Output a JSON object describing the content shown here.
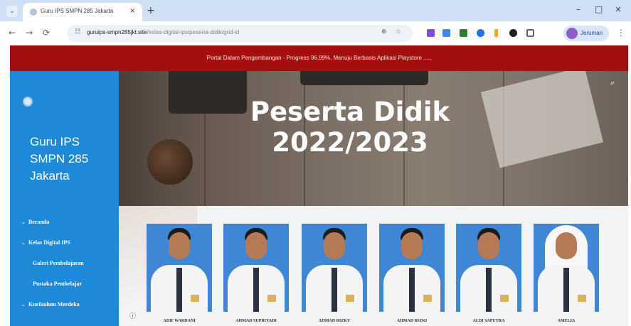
{
  "browser": {
    "tab_title": "Guru IPS SMPN 285 Jakarta",
    "tab_close": "×",
    "new_tab": "+",
    "minimize": "–",
    "maximize": "□",
    "close": "×",
    "url_domain": "guruips-smpn285jkt.site",
    "url_path": "/kelas-digital-ips/peserta-didik/grid-id",
    "profile_label": "Jeruman",
    "back": "←",
    "forward": "→",
    "reload": "⟳",
    "menu": "⋮",
    "extension_colors": [
      "#7b4fd6",
      "#4285f4",
      "#2e7d32",
      "#1a73e8",
      "#f9ab00",
      "#202124",
      "#5f6368"
    ]
  },
  "announcement": "Portal Dalam Pengembangan - Progress 96,99%, Menuju Berbasis Aplikasi Playstore .....",
  "sidebar": {
    "site_title_lines": [
      "Guru IPS",
      "SMPN 285",
      "Jakarta"
    ],
    "menu": [
      {
        "label": "Beranda",
        "caret": "⌄"
      },
      {
        "label": "Kelas Digital IPS",
        "caret": "⌄"
      },
      {
        "label": "Galeri Pembelajaran",
        "caret": ""
      },
      {
        "label": "Pustaka Pembelajar",
        "caret": ""
      },
      {
        "label": "Kurikulum Merdeka",
        "caret": "⌄"
      }
    ]
  },
  "hero": {
    "title_line1": "Peserta Didik",
    "title_line2": "2022/2023"
  },
  "students": [
    {
      "name": "ADIF WARDANI",
      "hijab": false
    },
    {
      "name": "AHMAD SUPRIYADI",
      "hijab": false
    },
    {
      "name": "AHMAD RIZKY",
      "hijab": false
    },
    {
      "name": "AHMAD RIZKI",
      "hijab": false
    },
    {
      "name": "ALDI SAPUTRA",
      "hijab": false
    },
    {
      "name": "AMELIA",
      "hijab": true
    }
  ],
  "colors": {
    "announcement_bg": "#a40e0e",
    "sidebar_bg": "#1e88d9",
    "photo_bg": "#3f86d4"
  }
}
